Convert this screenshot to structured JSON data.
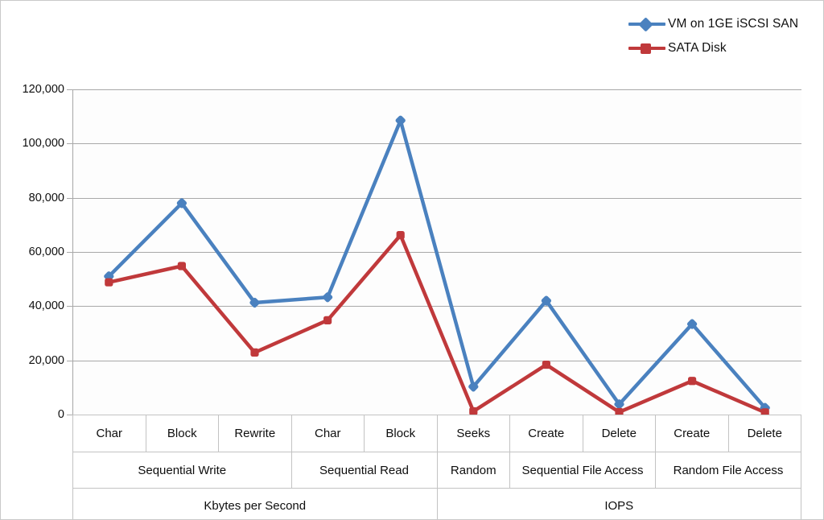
{
  "legend": {
    "position": "top-right",
    "items": [
      {
        "label": "VM on 1GE iSCSI SAN",
        "color": "#4a81bf",
        "marker": "diamond"
      },
      {
        "label": "SATA Disk",
        "color": "#c0393b",
        "marker": "square"
      }
    ]
  },
  "axis": {
    "y_ticks": [
      "0",
      "20,000",
      "40,000",
      "60,000",
      "80,000",
      "100,000",
      "120,000"
    ]
  },
  "categories": {
    "leaf": [
      "Char",
      "Block",
      "Rewrite",
      "Char",
      "Block",
      "Seeks",
      "Create",
      "Delete",
      "Create",
      "Delete"
    ],
    "groups": [
      {
        "label": "Sequential Write",
        "span": 3
      },
      {
        "label": "Sequential Read",
        "span": 2
      },
      {
        "label": "Random",
        "span": 1
      },
      {
        "label": "Sequential File Access",
        "span": 2
      },
      {
        "label": "Random File Access",
        "span": 2
      }
    ],
    "units": [
      {
        "label": "Kbytes per Second",
        "span": 5
      },
      {
        "label": "IOPS",
        "span": 5
      }
    ]
  },
  "chart_data": {
    "type": "line",
    "title": "",
    "xlabel": "",
    "ylabel": "",
    "ylim": [
      0,
      120000
    ],
    "ytick_step": 20000,
    "grid": true,
    "legend_position": "top-right",
    "categories": [
      "Char",
      "Block",
      "Rewrite",
      "Char",
      "Block",
      "Seeks",
      "Create",
      "Delete",
      "Create",
      "Delete"
    ],
    "category_groups": [
      "Sequential Write",
      "Sequential Write",
      "Sequential Write",
      "Sequential Read",
      "Sequential Read",
      "Random",
      "Sequential File Access",
      "Sequential File Access",
      "Random File Access",
      "Random File Access"
    ],
    "category_units": [
      "Kbytes per Second",
      "Kbytes per Second",
      "Kbytes per Second",
      "Kbytes per Second",
      "Kbytes per Second",
      "IOPS",
      "IOPS",
      "IOPS",
      "IOPS",
      "IOPS"
    ],
    "series": [
      {
        "name": "VM on 1GE iSCSI SAN",
        "color": "#4a81bf",
        "marker": "diamond",
        "values": [
          51000,
          78000,
          41300,
          43300,
          108500,
          10300,
          42000,
          3800,
          33400,
          2500
        ]
      },
      {
        "name": "SATA Disk",
        "color": "#c0393b",
        "marker": "square",
        "values": [
          48800,
          54800,
          22900,
          34800,
          66200,
          1200,
          18400,
          900,
          12400,
          800
        ]
      }
    ]
  }
}
